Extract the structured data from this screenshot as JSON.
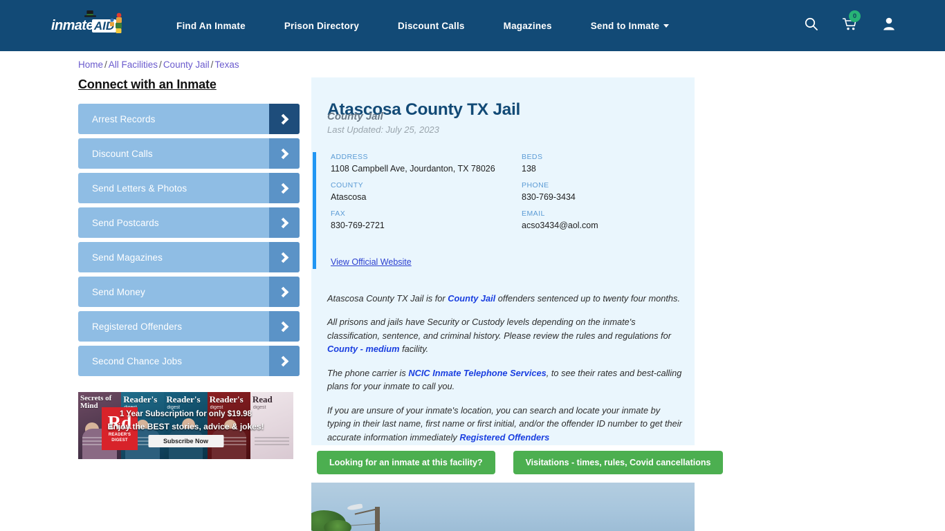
{
  "header": {
    "logo_text": "inmate",
    "logo_badge": "AID",
    "nav": [
      {
        "label": "Find An Inmate",
        "caret": false
      },
      {
        "label": "Prison Directory",
        "caret": false
      },
      {
        "label": "Discount Calls",
        "caret": false
      },
      {
        "label": "Magazines",
        "caret": false
      },
      {
        "label": "Send to Inmate",
        "caret": true
      }
    ],
    "icons": {
      "search": "search-icon",
      "cart": "cart-icon",
      "cart_count": "0",
      "account": "user-icon"
    },
    "bar_color": "#124a76",
    "badge_color": "#27b376"
  },
  "breadcrumb": {
    "items": [
      "Home",
      "All Facilities",
      "County Jail",
      "Texas"
    ],
    "separator": "/"
  },
  "sidebar": {
    "heading": "Connect with an Inmate",
    "items": [
      {
        "label": "Arrest Records",
        "active": true
      },
      {
        "label": "Discount Calls",
        "active": false
      },
      {
        "label": "Send Letters & Photos",
        "active": false
      },
      {
        "label": "Send Postcards",
        "active": false
      },
      {
        "label": "Send Magazines",
        "active": false
      },
      {
        "label": "Send Money",
        "active": false
      },
      {
        "label": "Registered Offenders",
        "active": false
      },
      {
        "label": "Second Chance Jobs",
        "active": false
      }
    ]
  },
  "advertisement": {
    "brand": "Rd",
    "brand_label": "READER'S DIGEST",
    "masthead": "Reader's",
    "masthead_sub": "digest",
    "headline": "1 Year Subscription for only $19.98",
    "subline": "Enjoy the BEST stories, advice & jokes!",
    "cta_label": "Subscribe Now",
    "cover_titles": [
      "Secrets of Mind",
      "Reader's",
      "Reader's",
      "Reader's",
      "Read"
    ]
  },
  "facility": {
    "title": "Atascosa County TX Jail",
    "subtitle": "County Jail",
    "last_updated": "Last Updated: July 25, 2023",
    "info": [
      {
        "label": "ADDRESS",
        "value": "1108 Campbell Ave, Jourdanton, TX 78026"
      },
      {
        "label": "BEDS",
        "value": "138"
      },
      {
        "label": "COUNTY",
        "value": "Atascosa"
      },
      {
        "label": "PHONE",
        "value": "830-769-3434"
      },
      {
        "label": "FAX",
        "value": "830-769-2721"
      },
      {
        "label": "EMAIL",
        "value": "acso3434@aol.com"
      }
    ],
    "official_website_label": "View Official Website",
    "accent_color": "#2196f3"
  },
  "description": {
    "p1_a": "Atascosa County TX Jail is for ",
    "p1_link": "County Jail",
    "p1_b": " offenders sentenced up to twenty four months.",
    "p2_a": "All prisons and jails have Security or Custody levels depending on the inmate's classification, sentence, and criminal history. Please review the rules and regulations for ",
    "p2_link": "County - medium",
    "p2_b": " facility.",
    "p3_a": "The phone carrier is ",
    "p3_link": "NCIC Inmate Telephone Services",
    "p3_b": ", to see their rates and best-calling plans for your inmate to call you.",
    "p4_a": "If you are unsure of your inmate's location, you can search and locate your inmate by typing in their last name, first name or first initial, and/or the offender ID number to get their accurate information immediately ",
    "p4_link": "Registered Offenders"
  },
  "cta_buttons": [
    {
      "label": "Looking for an inmate at this facility?"
    },
    {
      "label": "Visitations - times, rules, Covid cancellations"
    }
  ],
  "photo": {
    "name": "facility-street-view-photo"
  }
}
